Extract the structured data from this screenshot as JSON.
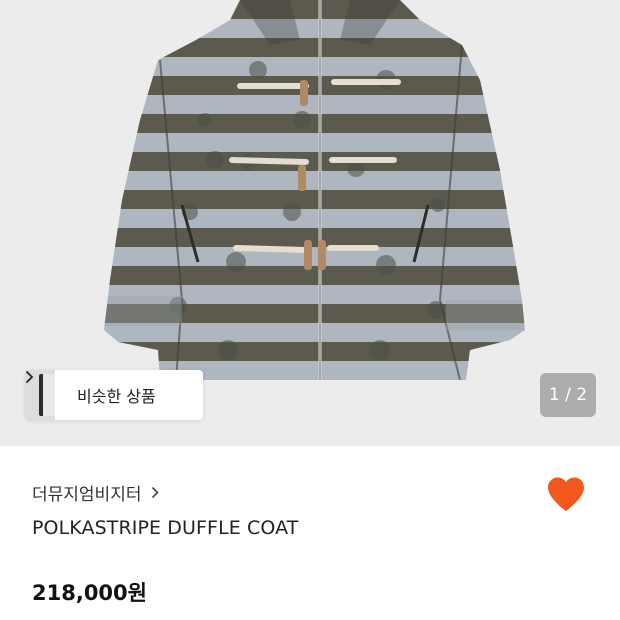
{
  "gallery": {
    "similar_label": "비슷한 상품",
    "pager_text": "1 / 2"
  },
  "product": {
    "store_name": "더뮤지엄비지터",
    "name": "POLKASTRIPE DUFFLE COAT",
    "price": "218,000원",
    "favorited": true
  },
  "colors": {
    "heart": "#f2571c",
    "stripe_dark": "#5c5a4f",
    "stripe_light": "#aeb7c0"
  },
  "icons": {
    "chevron": "chevron-right-icon",
    "heart": "heart-icon"
  }
}
